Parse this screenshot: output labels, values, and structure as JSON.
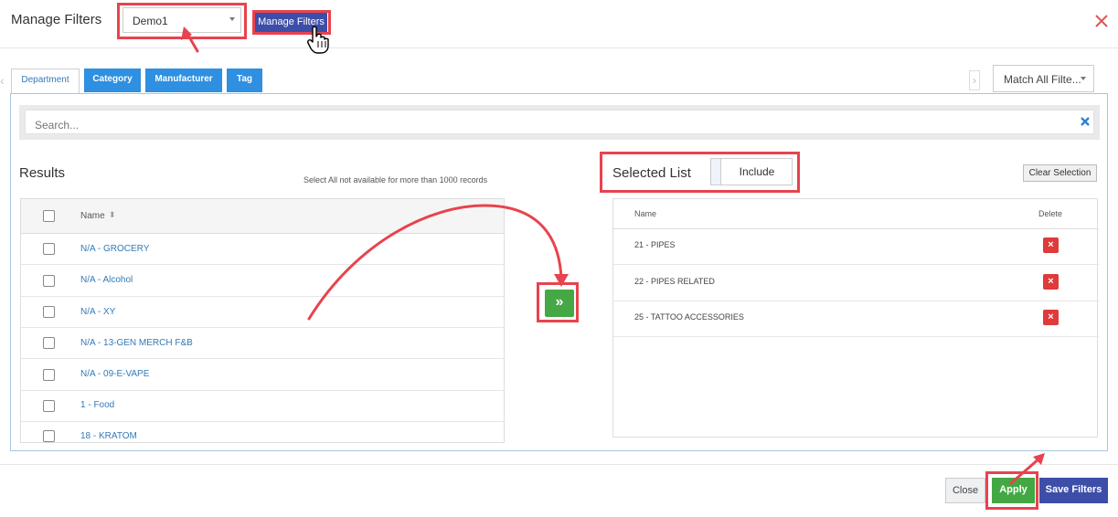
{
  "modal": {
    "title": "Manage Filters",
    "preset_value": "Demo1",
    "manage_button": "Manage Filters"
  },
  "tabs": [
    {
      "label": "Department",
      "active": true
    },
    {
      "label": "Category",
      "active": false
    },
    {
      "label": "Manufacturer",
      "active": false
    },
    {
      "label": "Tag",
      "active": false
    }
  ],
  "match_mode": "Match All Filte...",
  "search": {
    "placeholder": "Search..."
  },
  "results": {
    "title": "Results",
    "note": "Select All not available for more than 1000 records",
    "column_name": "Name",
    "rows": [
      "N/A - GROCERY",
      "N/A - Alcohol",
      "N/A - XY",
      "N/A - 13-GEN MERCH F&B",
      "N/A - 09-E-VAPE",
      "1 - Food",
      "18 - KRATOM"
    ]
  },
  "move_button": "»",
  "selected": {
    "title": "Selected List",
    "mode": "Include",
    "clear_label": "Clear Selection",
    "column_name": "Name",
    "column_delete": "Delete",
    "rows": [
      "21 - PIPES",
      "22 - PIPES RELATED",
      "25 - TATTOO ACCESSORIES"
    ]
  },
  "footer": {
    "close_label": "Close",
    "apply_label": "Apply",
    "save_label": "Save Filters"
  },
  "colors": {
    "accent_blue": "#2f8fe0",
    "primary_indigo": "#3d4ea8",
    "success_green": "#43a843",
    "danger_red": "#e03a3a",
    "annotation_red": "#e8434e"
  }
}
